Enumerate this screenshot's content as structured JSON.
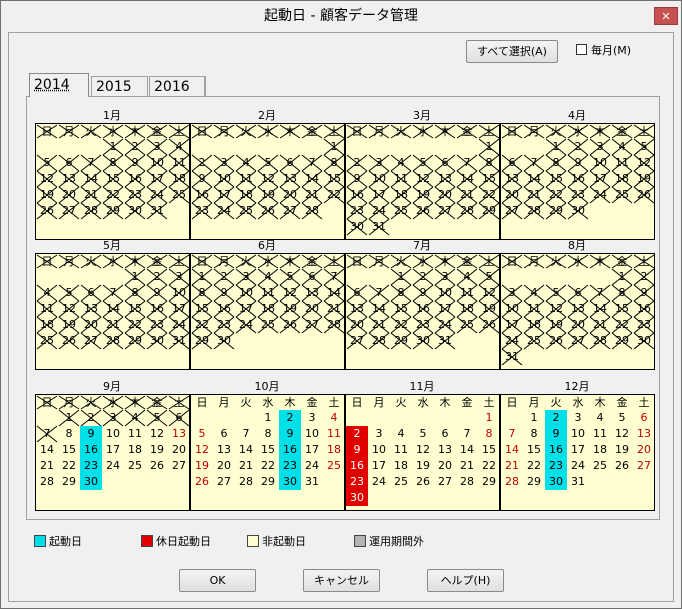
{
  "window": {
    "title": "起動日 - 顧客データ管理",
    "close_label": "✕"
  },
  "toolbar": {
    "select_all_label": "すべて選択(A)",
    "monthly_label": "毎月(M)"
  },
  "tabs": [
    "2014",
    "2015",
    "2016"
  ],
  "weekday_headers": [
    "日",
    "月",
    "火",
    "水",
    "木",
    "金",
    "土"
  ],
  "months": [
    {
      "label": "1月",
      "start": 3,
      "days": 31,
      "crossed_through": 31,
      "cyan": [],
      "holiday": [],
      "red": []
    },
    {
      "label": "2月",
      "start": 6,
      "days": 28,
      "crossed_through": 28,
      "cyan": [],
      "holiday": [],
      "red": []
    },
    {
      "label": "3月",
      "start": 6,
      "days": 31,
      "crossed_through": 31,
      "cyan": [],
      "holiday": [],
      "red": []
    },
    {
      "label": "4月",
      "start": 2,
      "days": 30,
      "crossed_through": 30,
      "cyan": [],
      "holiday": [],
      "red": []
    },
    {
      "label": "5月",
      "start": 4,
      "days": 31,
      "crossed_through": 31,
      "cyan": [],
      "holiday": [],
      "red": []
    },
    {
      "label": "6月",
      "start": 0,
      "days": 30,
      "crossed_through": 30,
      "cyan": [],
      "holiday": [],
      "red": []
    },
    {
      "label": "7月",
      "start": 2,
      "days": 31,
      "crossed_through": 31,
      "cyan": [],
      "holiday": [],
      "red": []
    },
    {
      "label": "8月",
      "start": 5,
      "days": 31,
      "crossed_through": 31,
      "cyan": [],
      "holiday": [],
      "red": []
    },
    {
      "label": "9月",
      "start": 1,
      "days": 30,
      "crossed_through": 7,
      "cyan": [
        9,
        16,
        23,
        30
      ],
      "holiday": [],
      "red": [
        13
      ]
    },
    {
      "label": "10月",
      "start": 3,
      "days": 31,
      "crossed_through": 0,
      "cyan": [
        2,
        9,
        16,
        23,
        30
      ],
      "holiday": [],
      "red": [
        4,
        5,
        11,
        12,
        18,
        19,
        25,
        26
      ]
    },
    {
      "label": "11月",
      "start": 6,
      "days": 30,
      "crossed_through": 0,
      "cyan": [],
      "holiday": [
        2,
        9,
        16,
        23,
        30
      ],
      "red": [
        1,
        8
      ]
    },
    {
      "label": "12月",
      "start": 1,
      "days": 31,
      "crossed_through": 0,
      "cyan": [
        2,
        9,
        16,
        23,
        30
      ],
      "holiday": [],
      "red": [
        6,
        7,
        13,
        14,
        20,
        21,
        27,
        28
      ]
    }
  ],
  "legend": [
    {
      "label": "起動日",
      "color": "#00e0e8"
    },
    {
      "label": "休日起動日",
      "color": "#e00000"
    },
    {
      "label": "非起動日",
      "color": "#fffed1"
    },
    {
      "label": "運用期間外",
      "color": "#b4b4b4"
    }
  ],
  "buttons": {
    "ok": "OK",
    "cancel": "キャンセル",
    "help": "ヘルプ(H)"
  }
}
